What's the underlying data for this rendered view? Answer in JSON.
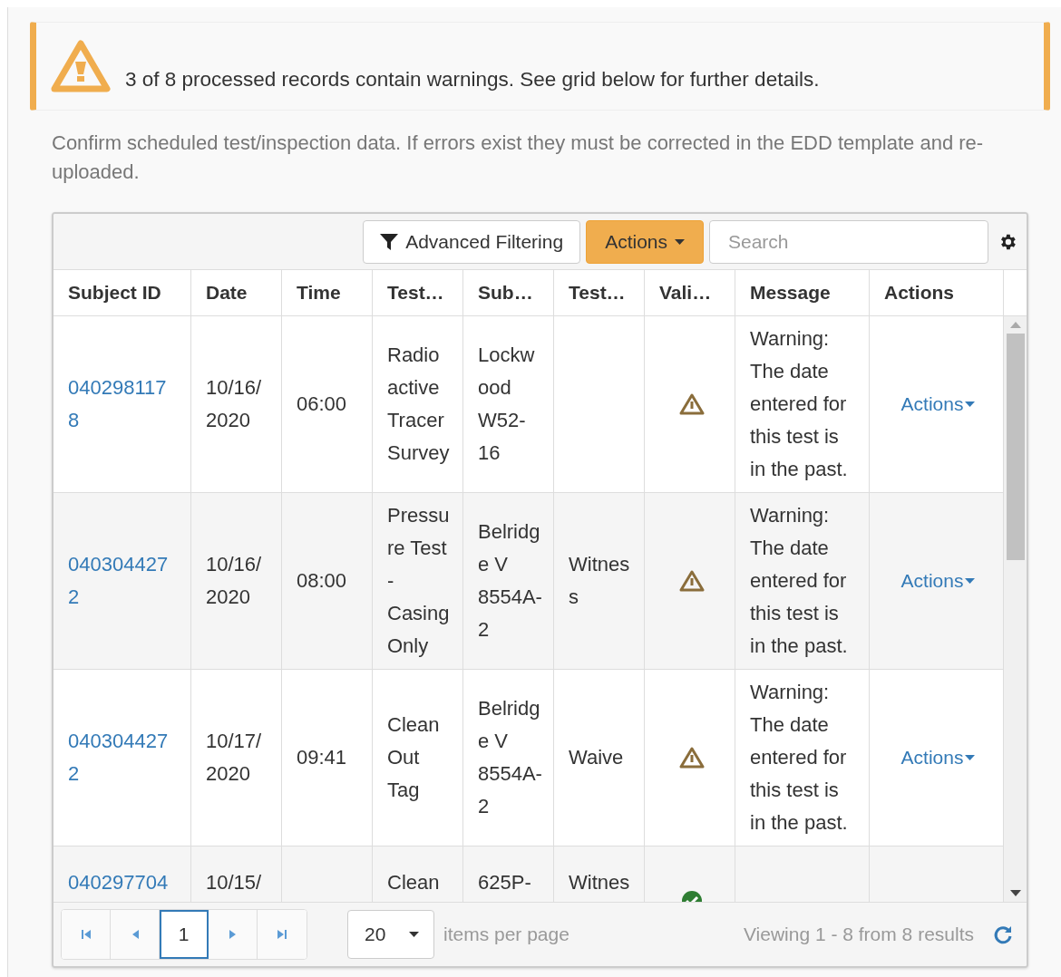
{
  "alert": {
    "message": "3 of 8 processed records contain warnings. See grid below for further details."
  },
  "instructions": "Confirm scheduled test/inspection data. If errors exist they must be corrected in the EDD template and re-uploaded.",
  "toolbar": {
    "filter_button": "Advanced Filtering",
    "actions_button": "Actions",
    "search": {
      "placeholder": "Search"
    }
  },
  "table": {
    "columns": [
      "Subject ID",
      "Date",
      "Time",
      "Test…",
      "Sub…",
      "Test…",
      "Vali…",
      "Message",
      "Actions"
    ],
    "rows": [
      {
        "subject_id": "0402981178",
        "date": "10/16/2020",
        "time": "06:00",
        "test": "Radio active Tracer Survey",
        "sub": "Lockwood W52-16",
        "result": "",
        "validation": {
          "kind": "warning"
        },
        "message": "Warning: The date entered for this test is in the past.",
        "action": "Actions"
      },
      {
        "subject_id": "0403044272",
        "date": "10/16/2020",
        "time": "08:00",
        "test": "Pressure Test - Casing Only",
        "sub": "Belridge V 8554A-2",
        "result": "Witness",
        "validation": {
          "kind": "warning"
        },
        "message": "Warning: The date entered for this test is in the past.",
        "action": "Actions"
      },
      {
        "subject_id": "0403044272",
        "date": "10/17/2020",
        "time": "09:41",
        "test": "Clean Out Tag",
        "sub": "Belridge V 8554A-2",
        "result": "Waive",
        "validation": {
          "kind": "warning"
        },
        "message": "Warning: The date entered for this test is in the past.",
        "action": "Actions"
      },
      {
        "subject_id": "040297704",
        "date": "10/15/",
        "time": "",
        "test": "Clean",
        "sub": "625P-",
        "result": "Witnes",
        "validation": {
          "kind": "ok"
        },
        "message": "",
        "action": ""
      }
    ]
  },
  "pager": {
    "buttons": [
      {
        "kind": "first",
        "selected": false
      },
      {
        "kind": "prev",
        "selected": false
      },
      {
        "kind": "page",
        "label": "1",
        "selected": true
      },
      {
        "kind": "next",
        "selected": false
      },
      {
        "kind": "last",
        "selected": false
      }
    ],
    "page_size": "20",
    "page_size_label": "items per page",
    "summary": "Viewing 1 - 8 from 8 results"
  }
}
